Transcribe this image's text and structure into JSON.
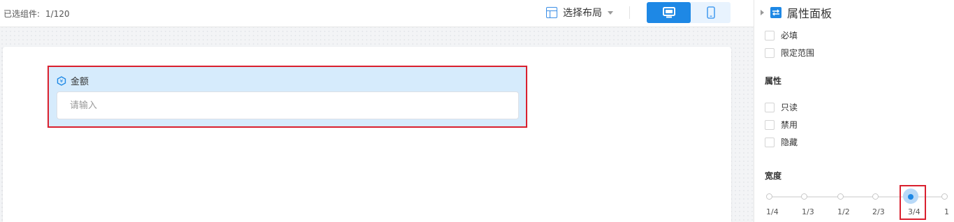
{
  "toolbar": {
    "selected_label": "已选组件:",
    "selected_count": "1/120",
    "layout_label": "选择布局"
  },
  "form": {
    "field_label": "金额",
    "field_placeholder": "请输入"
  },
  "panel": {
    "title": "属性面板",
    "validation": [
      {
        "label": "必填",
        "checked": false
      },
      {
        "label": "限定范围",
        "checked": false
      }
    ],
    "attributes_title": "属性",
    "attributes": [
      {
        "label": "只读",
        "checked": false
      },
      {
        "label": "禁用",
        "checked": false
      },
      {
        "label": "隐藏",
        "checked": false
      }
    ],
    "width_title": "宽度",
    "width_options": [
      "1/4",
      "1/3",
      "1/2",
      "2/3",
      "3/4",
      "1"
    ],
    "width_selected": "3/4"
  },
  "colors": {
    "accent": "#1e88e5",
    "selection_outline": "#d9202e",
    "field_background": "#d6ebfc"
  },
  "icons": {
    "layout": "layout-grid-icon",
    "desktop": "desktop-monitor-icon",
    "mobile": "mobile-phone-icon",
    "field": "currency-hexagon-icon",
    "panel": "swap-arrows-icon"
  }
}
